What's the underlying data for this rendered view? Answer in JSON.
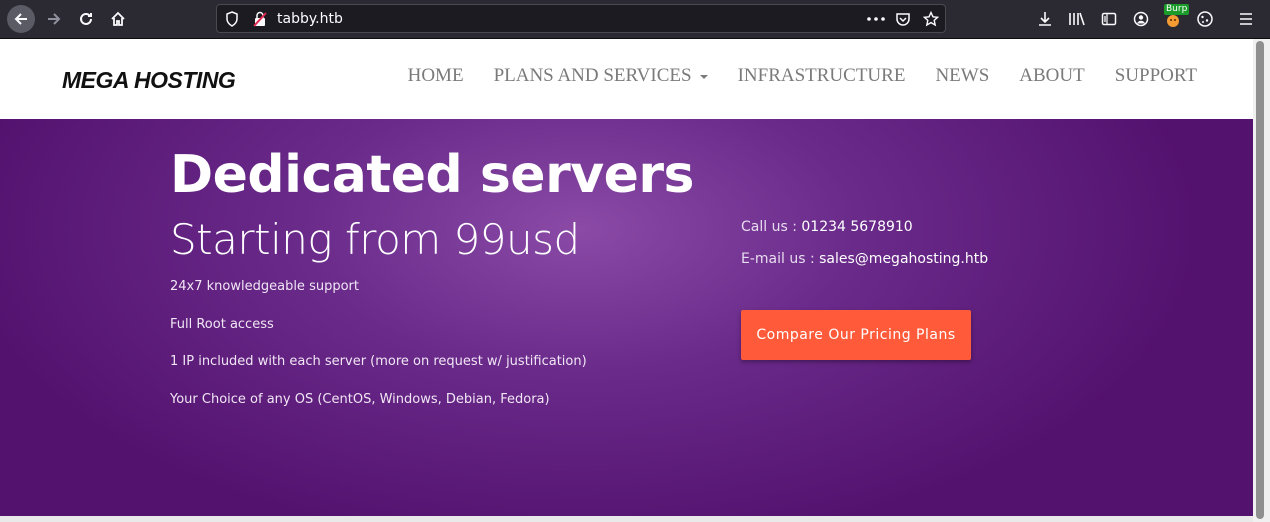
{
  "browser": {
    "url": "tabby.htb",
    "burp_badge": "Burp"
  },
  "site": {
    "logo": "MEGA HOSTING",
    "menu": [
      "HOME",
      "PLANS AND SERVICES",
      "INFRASTRUCTURE",
      "NEWS",
      "ABOUT",
      "SUPPORT"
    ]
  },
  "hero": {
    "title": "Dedicated servers",
    "subtitle": "Starting from 99usd",
    "features": [
      "24x7 knowledgeable support",
      "Full Root access",
      "1 IP included with each server (more on request w/ justification)",
      "Your Choice of any OS (CentOS, Windows, Debian, Fedora)"
    ],
    "call_label": "Call us : ",
    "call_value": "01234 5678910",
    "email_label": "E-mail us : ",
    "email_value": "sales@megahosting.htb",
    "cta_label": "Compare Our Pricing Plans"
  },
  "colors": {
    "hero_bg": "#5e1a7c",
    "cta": "#ff5b3a",
    "chrome": "#2b2a33"
  }
}
